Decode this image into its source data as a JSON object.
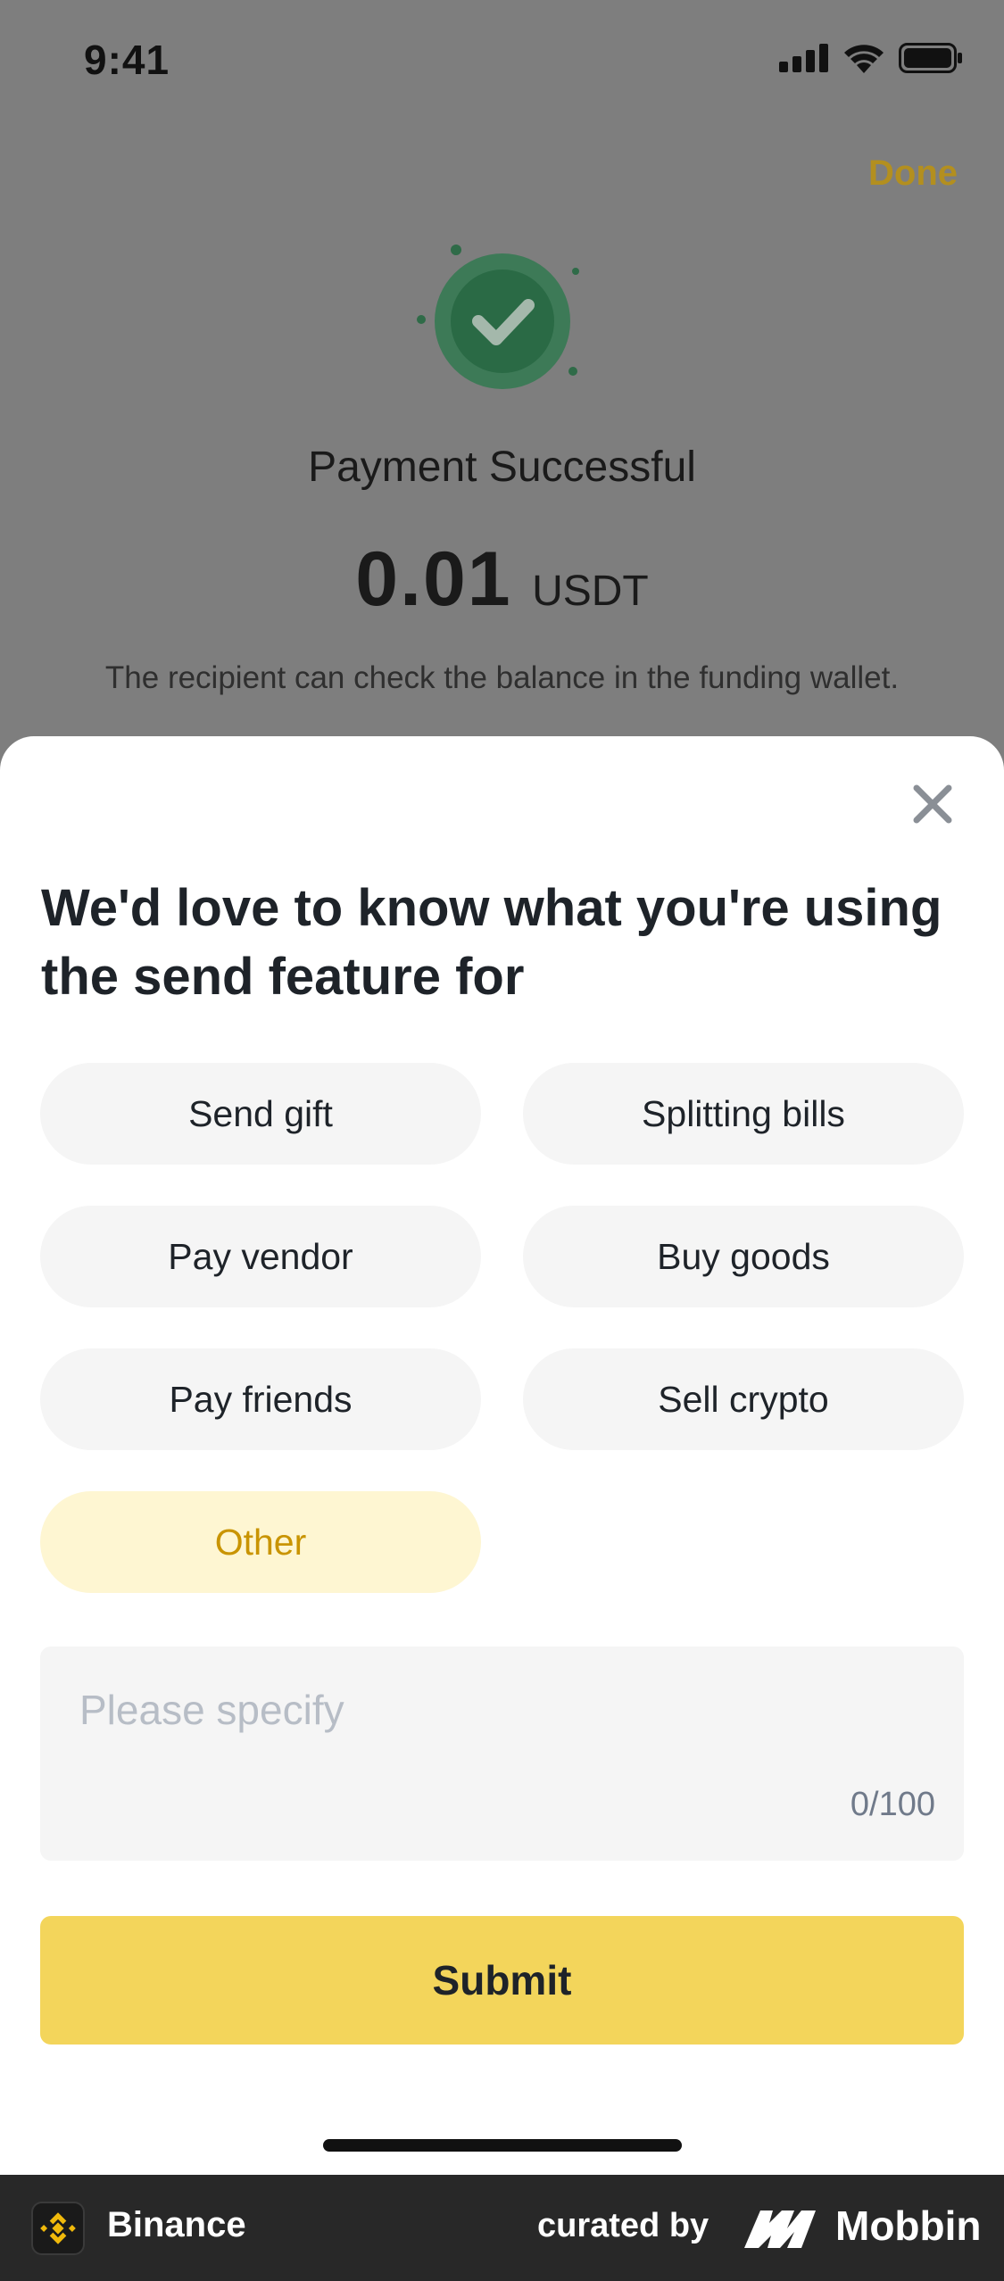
{
  "status_bar": {
    "time": "9:41"
  },
  "background": {
    "done_label": "Done",
    "payment_title": "Payment Successful",
    "amount_value": "0.01",
    "amount_unit": "USDT",
    "recipient_note": "The recipient can check the balance in the funding wallet."
  },
  "sheet": {
    "title": "We'd love to know what you're using the send feature for",
    "options": [
      {
        "label": "Send gift",
        "selected": false
      },
      {
        "label": "Splitting bills",
        "selected": false
      },
      {
        "label": "Pay vendor",
        "selected": false
      },
      {
        "label": "Buy goods",
        "selected": false
      },
      {
        "label": "Pay friends",
        "selected": false
      },
      {
        "label": "Sell crypto",
        "selected": false
      },
      {
        "label": "Other",
        "selected": true
      }
    ],
    "specify_placeholder": "Please specify",
    "specify_value": "",
    "char_count": "0/100",
    "submit_label": "Submit"
  },
  "footer": {
    "app_name": "Binance",
    "curated_by": "curated by",
    "brand": "Mobbin"
  },
  "colors": {
    "accent": "#f3d55b",
    "selected_bg": "#fef6d2",
    "selected_text": "#c99400",
    "success_green": "#2e8a4e"
  }
}
